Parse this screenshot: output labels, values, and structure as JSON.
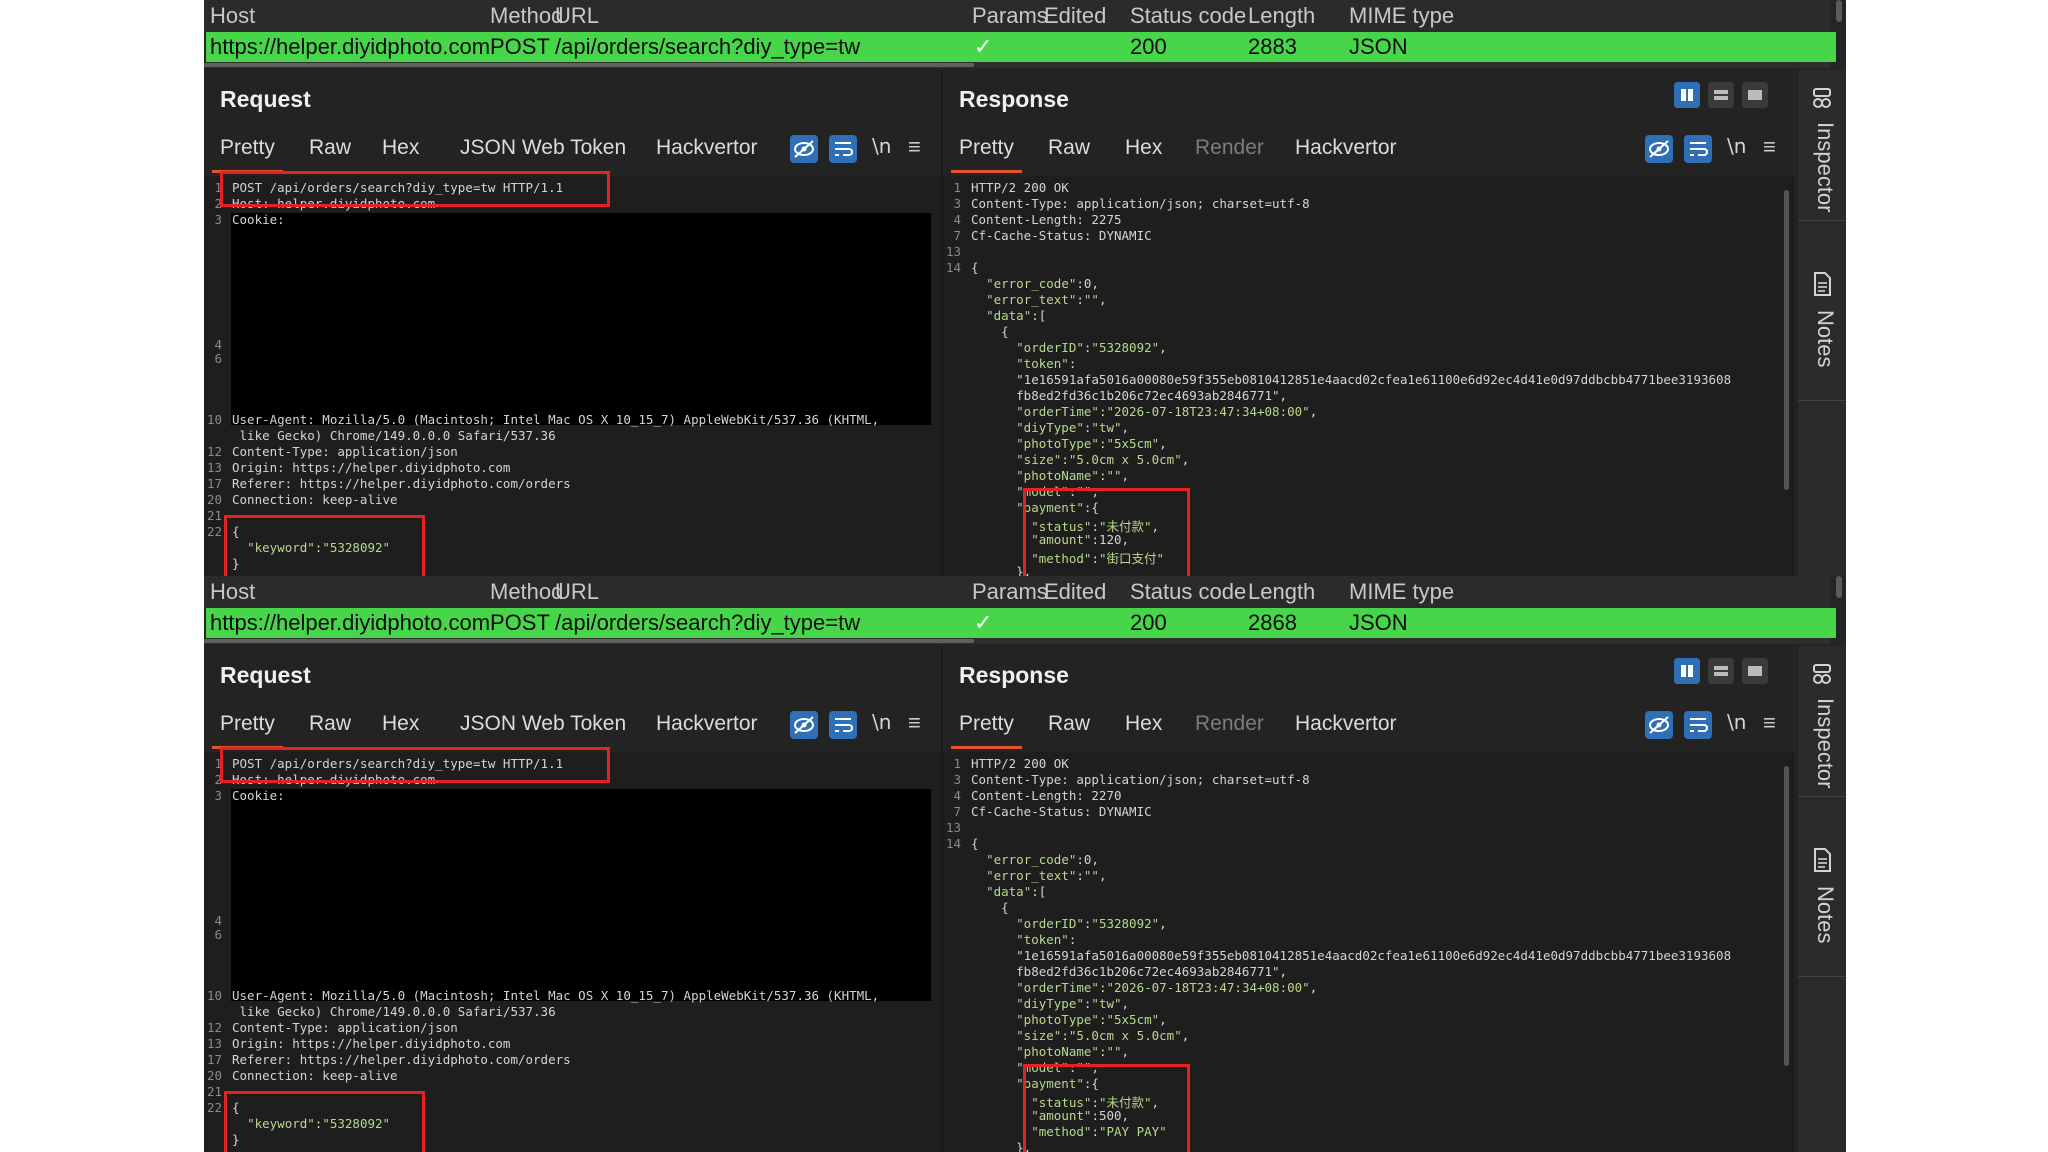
{
  "table": {
    "headers": [
      "Host",
      "Method",
      "URL",
      "Params",
      "Edited",
      "Status code",
      "Length",
      "MIME type"
    ]
  },
  "panels": [
    {
      "row": {
        "host": "https://helper.diyidphoto.com",
        "method": "POST",
        "url": "/api/orders/search?diy_type=tw",
        "params": "✓",
        "status": "200",
        "length": "2883",
        "mime": "JSON"
      },
      "request": {
        "title": "Request",
        "tabs": [
          "Pretty",
          "Raw",
          "Hex",
          "JSON Web Token",
          "Hackvertor"
        ],
        "newline_label": "\\n",
        "lines": [
          {
            "n": "1",
            "t": "POST /api/orders/search?diy_type=tw HTTP/1.1"
          },
          {
            "n": "2",
            "t": "Host: helper.diyidphoto.com"
          },
          {
            "n": "3",
            "t": "Cookie:"
          },
          {
            "n": "4",
            "t": ""
          },
          {
            "n": "6",
            "t": ""
          },
          {
            "n": "10",
            "t": "User-Agent: Mozilla/5.0 (Macintosh; Intel Mac OS X 10_15_7) AppleWebKit/537.36 (KHTML,"
          },
          {
            "n": "",
            "t": " like Gecko) Chrome/149.0.0.0 Safari/537.36"
          },
          {
            "n": "12",
            "t": "Content-Type: application/json"
          },
          {
            "n": "13",
            "t": "Origin: https://helper.diyidphoto.com"
          },
          {
            "n": "17",
            "t": "Referer: https://helper.diyidphoto.com/orders"
          },
          {
            "n": "20",
            "t": "Connection: keep-alive"
          },
          {
            "n": "21",
            "t": ""
          },
          {
            "n": "22",
            "t": "{"
          },
          {
            "n": "",
            "t": "  \"keyword\":\"5328092\""
          },
          {
            "n": "",
            "t": "}"
          }
        ]
      },
      "response": {
        "title": "Response",
        "tabs": [
          "Pretty",
          "Raw",
          "Hex",
          "Render",
          "Hackvertor"
        ],
        "newline_label": "\\n",
        "lines": [
          {
            "n": "1",
            "t": "HTTP/2 200 OK"
          },
          {
            "n": "3",
            "t": "Content-Type: application/json; charset=utf-8"
          },
          {
            "n": "4",
            "t": "Content-Length: 2275"
          },
          {
            "n": "7",
            "t": "Cf-Cache-Status: DYNAMIC"
          },
          {
            "n": "13",
            "t": ""
          },
          {
            "n": "14",
            "t": "{"
          },
          {
            "n": "",
            "t": "  \"error_code\":0,"
          },
          {
            "n": "",
            "t": "  \"error_text\":\"\","
          },
          {
            "n": "",
            "t": "  \"data\":["
          },
          {
            "n": "",
            "t": "    {"
          },
          {
            "n": "",
            "t": "      \"orderID\":\"5328092\","
          },
          {
            "n": "",
            "t": "      \"token\":"
          },
          {
            "n": "",
            "t": "      \"1e16591afa5016a00080e59f355eb0810412851e4aacd02cfea1e61100e6d92ec4d41e0d97ddbcbb4771bee3193608"
          },
          {
            "n": "",
            "t": "      fb8ed2fd36c1b206c72ec4693ab2846771\","
          },
          {
            "n": "",
            "t": "      \"orderTime\":\"2026-07-18T23:47:34+08:00\","
          },
          {
            "n": "",
            "t": "      \"diyType\":\"tw\","
          },
          {
            "n": "",
            "t": "      \"photoType\":\"5x5cm\","
          },
          {
            "n": "",
            "t": "      \"size\":\"5.0cm x 5.0cm\","
          },
          {
            "n": "",
            "t": "      \"photoName\":\"\","
          },
          {
            "n": "",
            "t": "      \"model\":\"\","
          },
          {
            "n": "",
            "t": "      \"payment\":{"
          },
          {
            "n": "",
            "t": "        \"status\":\"未付款\","
          },
          {
            "n": "",
            "t": "        \"amount\":120,"
          },
          {
            "n": "",
            "t": "        \"method\":\"街口支付\""
          },
          {
            "n": "",
            "t": "      },"
          }
        ]
      }
    },
    {
      "row": {
        "host": "https://helper.diyidphoto.com",
        "method": "POST",
        "url": "/api/orders/search?diy_type=tw",
        "params": "✓",
        "status": "200",
        "length": "2868",
        "mime": "JSON"
      },
      "request": {
        "title": "Request",
        "tabs": [
          "Pretty",
          "Raw",
          "Hex",
          "JSON Web Token",
          "Hackvertor"
        ],
        "newline_label": "\\n",
        "lines": [
          {
            "n": "1",
            "t": "POST /api/orders/search?diy_type=tw HTTP/1.1"
          },
          {
            "n": "2",
            "t": "Host: helper.diyidphoto.com"
          },
          {
            "n": "3",
            "t": "Cookie:"
          },
          {
            "n": "4",
            "t": ""
          },
          {
            "n": "6",
            "t": ""
          },
          {
            "n": "10",
            "t": "User-Agent: Mozilla/5.0 (Macintosh; Intel Mac OS X 10_15_7) AppleWebKit/537.36 (KHTML,"
          },
          {
            "n": "",
            "t": " like Gecko) Chrome/149.0.0.0 Safari/537.36"
          },
          {
            "n": "12",
            "t": "Content-Type: application/json"
          },
          {
            "n": "13",
            "t": "Origin: https://helper.diyidphoto.com"
          },
          {
            "n": "17",
            "t": "Referer: https://helper.diyidphoto.com/orders"
          },
          {
            "n": "20",
            "t": "Connection: keep-alive"
          },
          {
            "n": "21",
            "t": ""
          },
          {
            "n": "22",
            "t": "{"
          },
          {
            "n": "",
            "t": "  \"keyword\":\"5328092\""
          },
          {
            "n": "",
            "t": "}"
          }
        ]
      },
      "response": {
        "title": "Response",
        "tabs": [
          "Pretty",
          "Raw",
          "Hex",
          "Render",
          "Hackvertor"
        ],
        "newline_label": "\\n",
        "lines": [
          {
            "n": "1",
            "t": "HTTP/2 200 OK"
          },
          {
            "n": "3",
            "t": "Content-Type: application/json; charset=utf-8"
          },
          {
            "n": "4",
            "t": "Content-Length: 2270"
          },
          {
            "n": "7",
            "t": "Cf-Cache-Status: DYNAMIC"
          },
          {
            "n": "13",
            "t": ""
          },
          {
            "n": "14",
            "t": "{"
          },
          {
            "n": "",
            "t": "  \"error_code\":0,"
          },
          {
            "n": "",
            "t": "  \"error_text\":\"\","
          },
          {
            "n": "",
            "t": "  \"data\":["
          },
          {
            "n": "",
            "t": "    {"
          },
          {
            "n": "",
            "t": "      \"orderID\":\"5328092\","
          },
          {
            "n": "",
            "t": "      \"token\":"
          },
          {
            "n": "",
            "t": "      \"1e16591afa5016a00080e59f355eb0810412851e4aacd02cfea1e61100e6d92ec4d41e0d97ddbcbb4771bee3193608"
          },
          {
            "n": "",
            "t": "      fb8ed2fd36c1b206c72ec4693ab2846771\","
          },
          {
            "n": "",
            "t": "      \"orderTime\":\"2026-07-18T23:47:34+08:00\","
          },
          {
            "n": "",
            "t": "      \"diyType\":\"tw\","
          },
          {
            "n": "",
            "t": "      \"photoType\":\"5x5cm\","
          },
          {
            "n": "",
            "t": "      \"size\":\"5.0cm x 5.0cm\","
          },
          {
            "n": "",
            "t": "      \"photoName\":\"\","
          },
          {
            "n": "",
            "t": "      \"model\":\"\","
          },
          {
            "n": "",
            "t": "      \"payment\":{"
          },
          {
            "n": "",
            "t": "        \"status\":\"未付款\","
          },
          {
            "n": "",
            "t": "        \"amount\":500,"
          },
          {
            "n": "",
            "t": "        \"method\":\"PAY PAY\""
          },
          {
            "n": "",
            "t": "      },"
          }
        ]
      }
    }
  ],
  "sidebar": {
    "items": [
      "Inspector",
      "Notes"
    ]
  },
  "colors": {
    "selected_row": "#47d64a",
    "highlight_box": "#e32222",
    "active_tab_underline": "#e5532d",
    "toggle_active": "#2f6fb6"
  },
  "icons": [
    "eye-slash-icon",
    "wrap-lines-icon",
    "menu-icon",
    "split-vertical-icon",
    "split-horizontal-icon",
    "single-pane-icon",
    "inspector-icon",
    "notes-icon"
  ]
}
